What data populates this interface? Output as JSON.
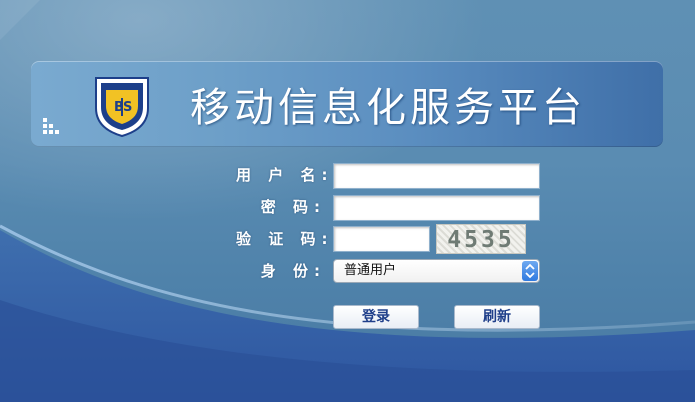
{
  "app": {
    "title": "移动信息化服务平台"
  },
  "form": {
    "username_label": "用 户 名:",
    "username_value": "",
    "password_label": "密   码:",
    "password_value": "",
    "captcha_label": "验 证 码:",
    "captcha_value": "",
    "captcha_code": "4535",
    "role_label": "身   份:",
    "role_selected": "普通用户"
  },
  "buttons": {
    "login": "登录",
    "refresh": "刷新"
  },
  "colors": {
    "background": "#5a8cb2",
    "header_gradient_start": "#7aaad0",
    "header_gradient_end": "#3f6fa8",
    "button_text": "#1f3f8a",
    "select_arrow": "#2f7ae0"
  },
  "icons": {
    "logo": "university-shield-logo",
    "decoration": "dot-grid-icon",
    "select_arrow": "chevron-updown-icon"
  }
}
